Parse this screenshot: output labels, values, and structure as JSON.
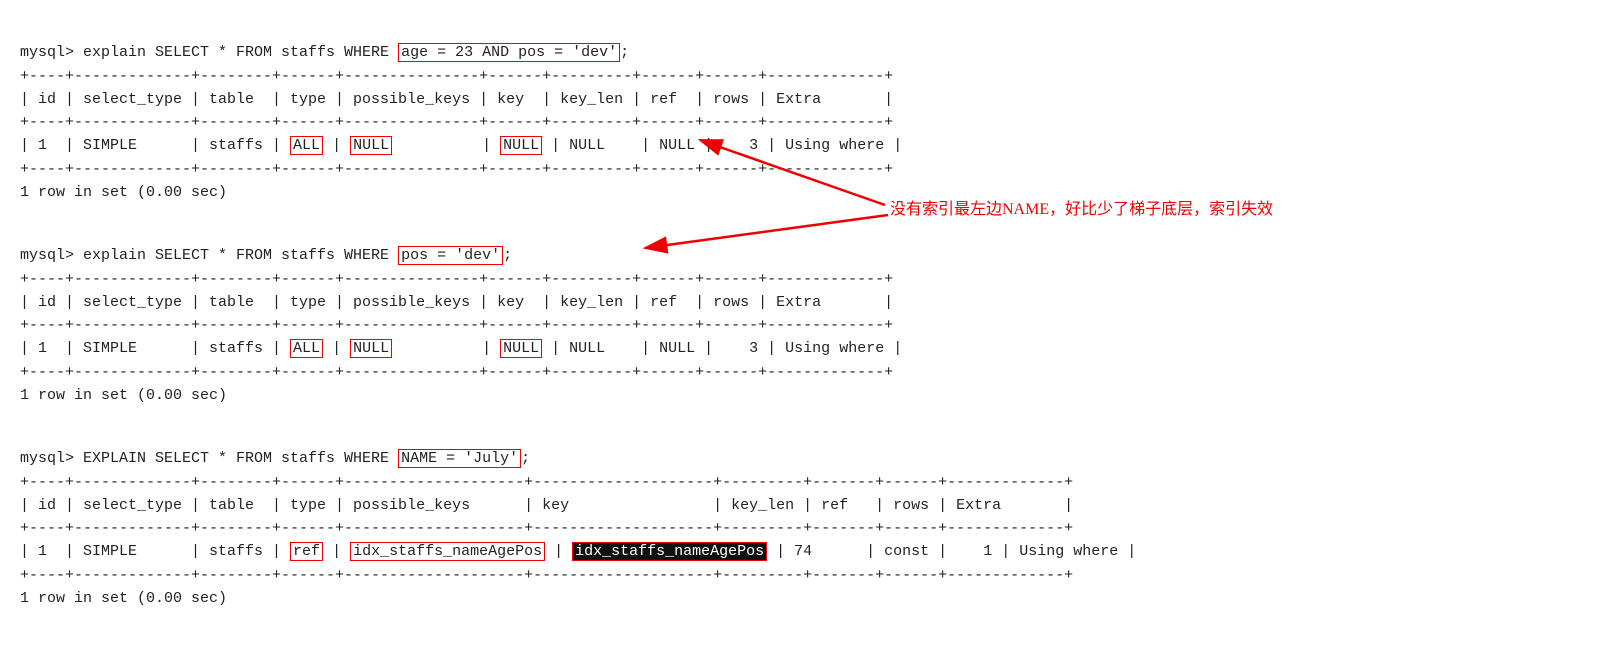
{
  "terminal": {
    "block1": {
      "cmd": "mysql> explain SELECT * FROM staffs WHERE ",
      "highlight1": "age = 23 AND pos = 'dev'",
      "cmd_end": ";",
      "divider1": "+----+-------------+--------+------+---------------+------+---------+------+------+-------------+",
      "header": "| id | select_type | table  | type | possible_keys | key  | key_len | ref  | rows | Extra       |",
      "divider2": "+----+-------------+--------+------+---------------+------+---------+------+------+-------------+",
      "row_highlight_type": "ALL",
      "row_highlight_keys": "NULL",
      "row_highlight_key": "NULL",
      "row_pre": "| 1  | SIMPLE      | staffs | ",
      "row_mid1": " | ",
      "row_mid2": "            | ",
      "row_mid3": " | NULL    | NULL |    3 | Using where |",
      "divider3": "+----+-------------+--------+------+---------------+------+---------+------+------+-------------+",
      "rowcount": "1 row in set (0.00 sec)"
    },
    "block2": {
      "cmd": "mysql> explain SELECT * FROM staffs WHERE ",
      "highlight": "pos = 'dev'",
      "cmd_end": ";",
      "divider1": "+----+-------------+--------+------+---------------+------+---------+------+------+-------------+",
      "header": "| id | select_type | table  | type | possible_keys | key  | key_len | ref  | rows | Extra       |",
      "divider2": "+----+-------------+--------+------+---------------+------+---------+------+------+-------------+",
      "row_pre": "| 1  | SIMPLE      | staffs | ",
      "row_highlight_type": "ALL",
      "row_highlight_keys": "NULL",
      "row_highlight_key": "NULL",
      "divider3": "+----+-------------+--------+------+---------------+------+---------+------+------+-------------+",
      "rowcount": "1 row in set (0.00 sec)"
    },
    "block3": {
      "cmd": "mysql> EXPLAIN SELECT * FROM staffs WHERE ",
      "highlight": "NAME = 'July'",
      "cmd_end": ";",
      "divider1": "+----+-------------+--------+------+--------------------+--------------------+---------+-------+------+-------------+",
      "header": "| id | select_type | table  | type | possible_keys      | key                | key_len | ref   | rows | Extra       |",
      "divider2": "+----+-------------+--------+------+--------------------+--------------------+---------+-------+------+-------------+",
      "row_pre": "| 1  | SIMPLE      | staffs | ",
      "row_highlight_type": "ref",
      "row_highlight_keys": "idx_staffs_nameAgePos",
      "row_highlight_key_black": "idx_staffs_nameAgePos",
      "row_end": " | 74      | const |    1 | Using where |",
      "divider3": "+----+-------------+--------+------+--------------------+--------------------+---------+-------+------+-------------+",
      "rowcount": "1 row in set (0.00 sec)"
    }
  },
  "annotation": {
    "text": "没有索引最左边NAME，好比少了梯子底层，索引失效"
  }
}
